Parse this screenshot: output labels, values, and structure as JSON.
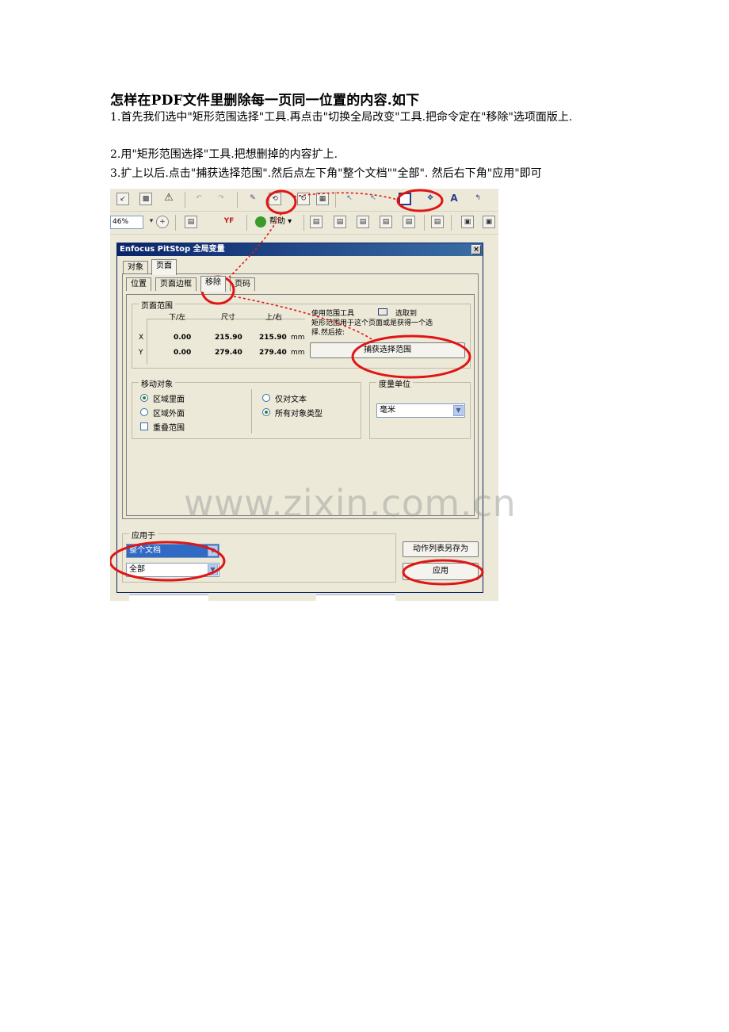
{
  "document": {
    "title": "怎样在PDF文件里删除每一页同一位置的内容.如下",
    "lines": [
      "1.首先我们选中\"矩形范围选择\"工具.再点击\"切换全局改变\"工具.把命令定在\"移除\"选项面版上.",
      "2.用\"矩形范围选择\"工具.把想删掉的内容扩上.",
      "3.扩上以后.点击\"捕获选择范围\".然后点左下角\"整个文档\"\"全部\". 然后右下角\"应用\"即可"
    ]
  },
  "screenshot": {
    "zoom_value": "46%",
    "help_label": "帮助",
    "dialog": {
      "title": "Enfocus PitStop 全局变量",
      "close_glyph": "×",
      "outer_tabs": [
        "对象",
        "页面"
      ],
      "inner_tabs": [
        "位置",
        "页面边框",
        "移除",
        "页码"
      ],
      "page_range": {
        "group_title": "页面范围",
        "col_headers": [
          "下/左",
          "尺寸",
          "上/右"
        ],
        "rows": [
          {
            "axis": "X",
            "low": "0.00",
            "size": "215.90",
            "high": "215.90",
            "unit": "mm"
          },
          {
            "axis": "Y",
            "low": "0.00",
            "size": "279.40",
            "high": "279.40",
            "unit": "mm"
          }
        ],
        "hint_line1": "使用范围工具",
        "hint_select": "选取到",
        "hint_line2": "矩形范围用于这个页面或是获得一个选",
        "hint_line3": "择.然后按:",
        "capture_button": "捕获选择范围"
      },
      "move_objects": {
        "group_title": "移动对象",
        "options_left": [
          {
            "label": "区域里面",
            "selected": true
          },
          {
            "label": "区域外面",
            "selected": false
          }
        ],
        "overlap_label": "重叠范围",
        "options_right": [
          {
            "label": "仅对文本",
            "selected": false
          },
          {
            "label": "所有对象类型",
            "selected": true
          }
        ]
      },
      "units": {
        "group_title": "度量单位",
        "value": "毫米"
      },
      "apply_to": {
        "group_title": "应用于",
        "scope_value": "整个文档",
        "pages_value": "全部"
      },
      "save_actionlist_button": "动作列表另存为",
      "apply_button": "应用"
    }
  },
  "watermark": "www.zixin.com.cn",
  "colors": {
    "annotation_red": "#e01515",
    "dialog_bg": "#ece9d8",
    "titlebar": "#0a246a",
    "selection": "#316ac5"
  }
}
